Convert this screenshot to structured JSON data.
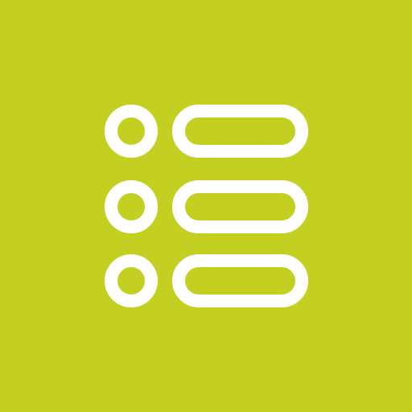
{
  "icon": {
    "name": "list-icon",
    "background_color": "#c3d022",
    "foreground_color": "#ffffff",
    "rows": 3
  }
}
